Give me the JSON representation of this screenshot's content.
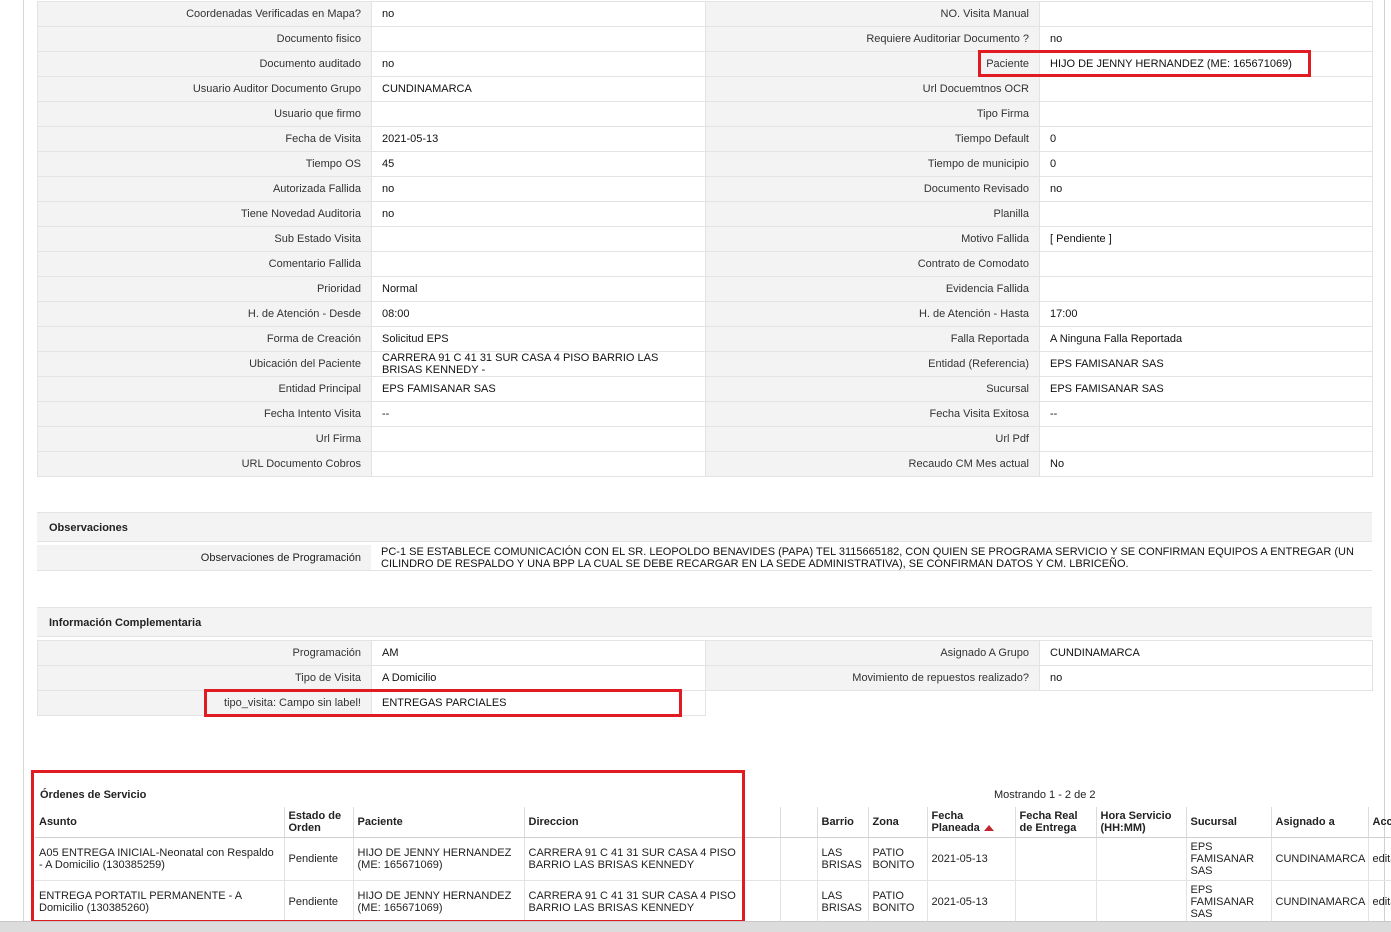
{
  "detail_rows": [
    {
      "l1": "Coordenadas Verificadas en Mapa?",
      "v1": "no",
      "l2": "NO. Visita Manual",
      "v2": ""
    },
    {
      "l1": "Documento fisico",
      "v1": "",
      "l2": "Requiere Auditoriar Documento ?",
      "v2": "no"
    },
    {
      "l1": "Documento auditado",
      "v1": "no",
      "l2": "Paciente",
      "v2": "HIJO DE JENNY HERNANDEZ (ME: 165671069)"
    },
    {
      "l1": "Usuario Auditor Documento Grupo",
      "v1": "CUNDINAMARCA",
      "l2": "Url Docuemtnos OCR",
      "v2": ""
    },
    {
      "l1": "Usuario que firmo",
      "v1": "",
      "l2": "Tipo Firma",
      "v2": ""
    },
    {
      "l1": "Fecha de Visita",
      "v1": " 2021-05-13",
      "l2": "Tiempo Default",
      "v2": "0"
    },
    {
      "l1": "Tiempo OS",
      "v1": "45",
      "l2": "Tiempo de municipio",
      "v2": "0"
    },
    {
      "l1": "Autorizada Fallida",
      "v1": "no",
      "l2": "Documento Revisado",
      "v2": "no"
    },
    {
      "l1": "Tiene Novedad Auditoria",
      "v1": "no",
      "l2": "Planilla",
      "v2": ""
    },
    {
      "l1": "Sub Estado Visita",
      "v1": "",
      "l2": "Motivo Fallida",
      "v2": "[ Pendiente ]"
    },
    {
      "l1": "Comentario Fallida",
      "v1": "",
      "l2": "Contrato de Comodato",
      "v2": ""
    },
    {
      "l1": "Prioridad",
      "v1": "Normal",
      "l2": "Evidencia Fallida",
      "v2": ""
    },
    {
      "l1": "H. de Atención - Desde",
      "v1": "08:00",
      "l2": "H. de Atención - Hasta",
      "v2": "17:00"
    },
    {
      "l1": "Forma de Creación",
      "v1": "Solicitud EPS",
      "l2": "Falla Reportada",
      "v2": "A Ninguna Falla Reportada"
    },
    {
      "l1": "Ubicación del Paciente",
      "v1": "CARRERA 91 C 41 31 SUR CASA 4 PISO BARRIO LAS BRISAS KENNEDY -",
      "l2": "Entidad (Referencia)",
      "v2": "EPS FAMISANAR SAS"
    },
    {
      "l1": "Entidad Principal",
      "v1": "EPS FAMISANAR SAS",
      "l2": "Sucursal",
      "v2": "EPS FAMISANAR SAS"
    },
    {
      "l1": "Fecha Intento Visita",
      "v1": "--",
      "l2": "Fecha Visita Exitosa",
      "v2": "--"
    },
    {
      "l1": "Url Firma",
      "v1": "",
      "l2": "Url Pdf",
      "v2": ""
    },
    {
      "l1": "URL Documento Cobros",
      "v1": "",
      "l2": "Recaudo CM Mes actual",
      "v2": "No"
    }
  ],
  "observaciones": {
    "title": "Observaciones",
    "label": "Observaciones de Programación",
    "value": "PC-1 SE ESTABLECE COMUNICACIÓN CON EL SR. LEOPOLDO BENAVIDES (PAPA) TEL 3115665182, CON QUIEN SE PROGRAMA SERVICIO Y SE CONFIRMAN EQUIPOS A ENTREGAR (UN CILINDRO DE RESPALDO Y UNA BPP LA CUAL SE DEBE RECARGAR EN LA SEDE ADMINISTRATIVA), SE CONFIRMAN DATOS Y CM. LBRICEÑO."
  },
  "complementaria": {
    "title": "Información Complementaria",
    "rows": [
      {
        "l1": "Programación",
        "v1": "AM",
        "l2": "Asignado A Grupo",
        "v2": "CUNDINAMARCA"
      },
      {
        "l1": "Tipo de Visita",
        "v1": "A Domicilio",
        "l2": "Movimiento de repuestos realizado?",
        "v2": "no"
      }
    ],
    "extra_label": "tipo_visita: Campo sin label!",
    "extra_value": "ENTREGAS PARCIALES"
  },
  "orders": {
    "title": "Órdenes de Servicio",
    "count_text": "Mostrando 1 - 2 de 2",
    "headers": {
      "asunto": "Asunto",
      "estado": "Estado de Orden",
      "paciente": "Paciente",
      "direccion": "Direccion",
      "blank": "",
      "barrio": "Barrio",
      "zona": "Zona",
      "fecha_planeada": "Fecha Planeada",
      "fecha_real": "Fecha Real de Entrega",
      "hora": "Hora Servicio (HH:MM)",
      "sucursal": "Sucursal",
      "asignado": "Asignado a",
      "accion": "Acción"
    },
    "rows": [
      {
        "asunto": "A05 ENTREGA INICIAL-Neonatal con Respaldo - A Domicilio (130385259)",
        "estado": "Pendiente",
        "paciente": "HIJO DE JENNY HERNANDEZ (ME: 165671069)",
        "direccion": "CARRERA 91 C 41 31 SUR CASA 4 PISO BARRIO LAS BRISAS KENNEDY",
        "blank": "",
        "barrio": "LAS BRISAS",
        "zona": "PATIO BONITO",
        "fecha_planeada": "2021-05-13",
        "fecha_real": "",
        "hora": "",
        "sucursal": "EPS FAMISANAR SAS",
        "asignado": "CUNDINAMARCA",
        "accion": "editar"
      },
      {
        "asunto": "ENTREGA PORTATIL PERMANENTE - A Domicilio (130385260)",
        "estado": "Pendiente",
        "paciente": "HIJO DE JENNY HERNANDEZ (ME: 165671069)",
        "direccion": "CARRERA 91 C 41 31 SUR CASA 4 PISO BARRIO LAS BRISAS KENNEDY",
        "blank": "",
        "barrio": "LAS BRISAS",
        "zona": "PATIO BONITO",
        "fecha_planeada": "2021-05-13",
        "fecha_real": "",
        "hora": "",
        "sucursal": "EPS FAMISANAR SAS",
        "asignado": "CUNDINAMARCA",
        "accion": "editar"
      }
    ]
  },
  "colors": {
    "highlight": "#e11b22",
    "label_bg": "#f3f3f3",
    "border": "#e3e3e3"
  }
}
